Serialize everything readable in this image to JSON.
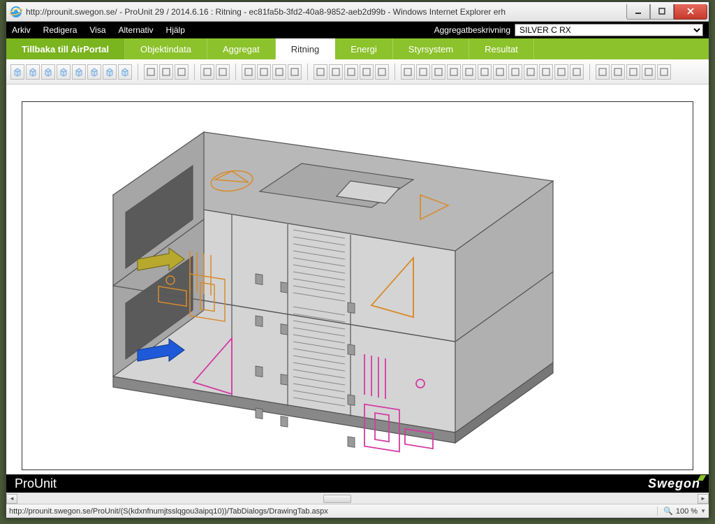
{
  "window": {
    "title": "http://prounit.swegon.se/ - ProUnit 29 / 2014.6.16 : Ritning - ec81fa5b-3fd2-40a8-9852-aeb2d99b - Windows Internet Explorer erh"
  },
  "menubar": {
    "items": [
      "Arkiv",
      "Redigera",
      "Visa",
      "Alternativ",
      "Hjälp"
    ],
    "agg_label": "Aggregatbeskrivning",
    "agg_value": "SILVER C RX"
  },
  "tabs": {
    "home": "Tillbaka till AirPortal",
    "items": [
      "Objektindata",
      "Aggregat",
      "Ritning",
      "Energi",
      "Styrsystem",
      "Resultat"
    ],
    "active": "Ritning"
  },
  "footer": {
    "left": "ProUnit",
    "right": "Swegon"
  },
  "statusbar": {
    "url": "http://prounit.swegon.se/ProUnit/(S(kdxnfnumjtsslqgou3aipq10))/TabDialogs/DrawingTab.aspx",
    "zoom": "100 %"
  },
  "toolbar_icons": [
    "view3d-1",
    "view3d-2",
    "view3d-3",
    "view3d-4",
    "view3d-5",
    "view3d-6",
    "view3d-7",
    "view3d-8",
    "sep",
    "align-1",
    "align-2",
    "align-3",
    "sep",
    "bracket-left",
    "bracket-right",
    "sep",
    "copy",
    "paste",
    "dim",
    "delete",
    "sep",
    "panel-1",
    "panel-2",
    "panel-3",
    "panel-4",
    "panel-5",
    "sep",
    "module-1",
    "module-2",
    "module-3",
    "module-4",
    "module-5",
    "module-6",
    "module-7",
    "module-8",
    "module-9",
    "module-10",
    "module-11",
    "module-12",
    "sep",
    "arrow-lr",
    "square",
    "save",
    "blank",
    "grid"
  ]
}
